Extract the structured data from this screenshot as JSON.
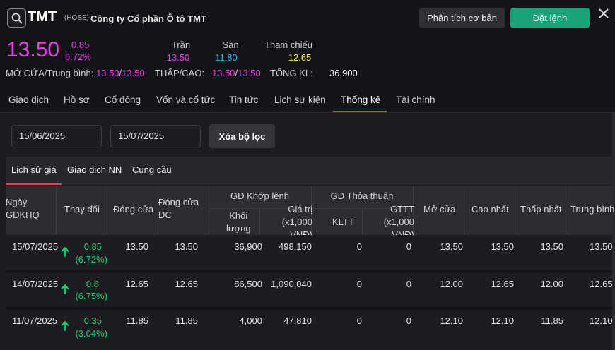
{
  "header": {
    "ticker": "TMT",
    "exchange": "(HOSE)",
    "company": "Công ty Cổ phần Ô tô TMT",
    "analysis_button": "Phân tích cơ bản",
    "order_button": "Đặt lệnh"
  },
  "quote": {
    "price": "13.50",
    "change": "0.85",
    "change_pct": "6.72%",
    "ceiling_label": "Trần",
    "ceiling": "13.50",
    "floor_label": "Sàn",
    "floor": "11.80",
    "reference_label": "Tham chiếu",
    "reference": "12.65",
    "open_avg_label": "MỞ CỬA/Trung bình:",
    "open": "13.50",
    "avg": "13.50",
    "low_high_label": "THẤP/CAO:",
    "low": "13.50",
    "high": "13.50",
    "volume_label": "TỔNG KL:",
    "volume": "36,900"
  },
  "tabs": [
    "Giao dịch",
    "Hồ sơ",
    "Cổ đông",
    "Vốn và cổ tức",
    "Tin tức",
    "Lịch sự kiện",
    "Thống kê",
    "Tài chính"
  ],
  "active_tab": "Thống kê",
  "filters": {
    "from_date": "15/06/2025",
    "to_date": "15/07/2025",
    "clear_button": "Xóa bộ lọc"
  },
  "subtabs": [
    "Lịch sử giá",
    "Giao dịch NN",
    "Cung cầu"
  ],
  "table": {
    "headers": {
      "date": [
        "Ngày",
        "GDKHQ"
      ],
      "change": "Thay đổi",
      "close": "Đóng cửa",
      "adj_close": [
        "Đóng cửa",
        "ĐC"
      ],
      "matched_group": "GD Khớp lệnh",
      "matched_volume": [
        "Khối",
        "lượng"
      ],
      "matched_value": [
        "Giá trị",
        "(x1,000",
        "VNĐ)"
      ],
      "deal_group": "GD Thỏa thuận",
      "deal_volume": "KLTT",
      "deal_value": [
        "GTTT",
        "(x1,000",
        "VNĐ)"
      ],
      "open": "Mở cửa",
      "high": "Cao nhất",
      "low": "Thấp nhất",
      "avg": "Trung bình"
    },
    "rows": [
      {
        "date": "15/07/2025",
        "change": "0.85",
        "change_pct": "(6.72%)",
        "close": "13.50",
        "adj_close": "13.50",
        "volume": "36,900",
        "value": "498,150",
        "deal_vol": "0",
        "deal_val": "0",
        "open": "13.50",
        "high": "13.50",
        "low": "13.50",
        "avg": "13.50"
      },
      {
        "date": "14/07/2025",
        "change": "0.8",
        "change_pct": "(6.75%)",
        "close": "12.65",
        "adj_close": "12.65",
        "volume": "86,500",
        "value": "1,090,040",
        "deal_vol": "0",
        "deal_val": "0",
        "open": "12.00",
        "high": "12.65",
        "low": "12.00",
        "avg": "12.65"
      },
      {
        "date": "11/07/2025",
        "change": "0.35",
        "change_pct": "(3.04%)",
        "close": "11.85",
        "adj_close": "11.85",
        "volume": "4,000",
        "value": "47,810",
        "deal_vol": "0",
        "deal_val": "0",
        "open": "12.10",
        "high": "12.10",
        "low": "11.85",
        "avg": "12.10"
      }
    ]
  },
  "colors": {
    "up": "#1fd46e",
    "ceiling": "#f23bf2",
    "floor": "#29b6f6",
    "reference": "#f5e663",
    "accent_tab": "#e0474c",
    "order_button": "#1aa37a"
  }
}
